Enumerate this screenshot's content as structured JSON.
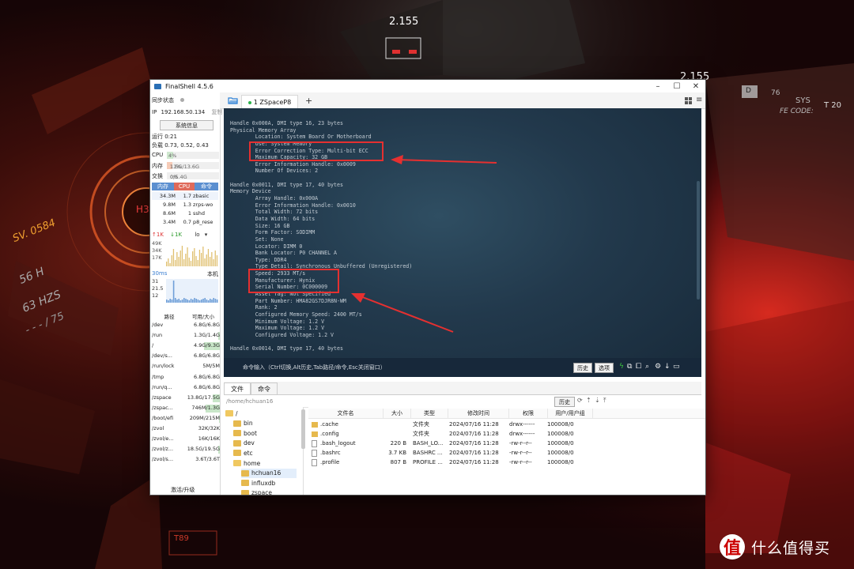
{
  "background": {
    "hud_top_1": "2.155",
    "hud_top_2": "2.155",
    "hud_sv": "SV. 0584",
    "hud_56": "56 H",
    "hud_63": "63 HZS",
    "hud_75": "- - - / 75",
    "hud_sys": "SYS",
    "hud_t20": "T 20",
    "hud_76": "76",
    "hud_fe": "FE CODE:",
    "hud_d": "D",
    "hud_t89": "T89",
    "hud_h3": "H3",
    "watermark_logo": "值",
    "watermark_text": "什么值得买"
  },
  "window": {
    "title": "FinalShell 4.5.6",
    "minimize": "–",
    "maximize": "☐",
    "close": "✕"
  },
  "sidebar": {
    "sync_label": "同步状态",
    "ip_label": "IP",
    "ip_value": "192.168.50.134",
    "copy_label": "复制",
    "sysinfo_button": "系统信息",
    "uptime": "运行 0:21",
    "load": "负载 0.73, 0.52, 0.43",
    "cpu_label": "CPU",
    "cpu_value": "4%",
    "cpu_fraction": 0.04,
    "mem_label": "内存",
    "mem_percent": "11%",
    "mem_value": "1.5G/13.6G",
    "mem_fraction": 0.11,
    "swap_label": "交换",
    "swap_percent": "0%",
    "swap_value": "0/5.4G",
    "proc_headers": [
      "内存",
      "CPU",
      "命令"
    ],
    "processes": [
      {
        "mem": "34.3M",
        "cpu": "1.7",
        "cmd": "zbasic"
      },
      {
        "mem": "9.8M",
        "cpu": "1.3",
        "cmd": "zrps-wo"
      },
      {
        "mem": "8.6M",
        "cpu": "1",
        "cmd": "sshd"
      },
      {
        "mem": "3.4M",
        "cpu": "0.7",
        "cmd": "p8_rese"
      }
    ],
    "net_up": "1K",
    "net_down": "1K",
    "net_iface": "lo",
    "net_ticks": [
      "49K",
      "34K",
      "17K"
    ],
    "latency_label": "30ms",
    "latency_host": "本机",
    "latency_ticks": [
      "31",
      "21.5",
      "12"
    ],
    "disk_headers": [
      "路径",
      "可用/大小"
    ],
    "disks": [
      {
        "path": "/dev",
        "size": "6.8G/6.8G",
        "fraction": 0.0
      },
      {
        "path": "/run",
        "size": "1.3G/1.4G",
        "fraction": 0.05
      },
      {
        "path": "/",
        "size": "4.9G/9.3G",
        "fraction": 0.47
      },
      {
        "path": "/dev/s...",
        "size": "6.8G/6.8G",
        "fraction": 0.0
      },
      {
        "path": "/run/lock",
        "size": "5M/5M",
        "fraction": 0.0
      },
      {
        "path": "/tmp",
        "size": "6.8G/6.8G",
        "fraction": 0.0
      },
      {
        "path": "/run/q...",
        "size": "6.8G/6.8G",
        "fraction": 0.0
      },
      {
        "path": "/zspace",
        "size": "13.8G/17.5G",
        "fraction": 0.21
      },
      {
        "path": "/zspac...",
        "size": "746M/1.3G",
        "fraction": 0.43
      },
      {
        "path": "/boot/efi",
        "size": "209M/215M",
        "fraction": 0.03
      },
      {
        "path": "/zvol",
        "size": "32K/32K",
        "fraction": 0.0
      },
      {
        "path": "/zvol/e...",
        "size": "16K/16K",
        "fraction": 0.0
      },
      {
        "path": "/zvol/z...",
        "size": "18.5G/19.5G",
        "fraction": 0.05
      },
      {
        "path": "/zvol/s...",
        "size": "3.6T/3.6T",
        "fraction": 0.0
      }
    ],
    "activate_label": "激活/升级"
  },
  "tabs": {
    "folder_icon": "folder-open-icon",
    "tab1_label": "1 ZSpaceP8",
    "add_label": "+"
  },
  "terminal": {
    "lines": [
      "Handle 0x000A, DMI type 16, 23 bytes",
      "Physical Memory Array",
      "        Location: System Board Or Motherboard",
      "        Use: System Memory",
      "        Error Correction Type: Multi-bit ECC",
      "        Maximum Capacity: 32 GB",
      "        Error Information Handle: 0x0009",
      "        Number Of Devices: 2",
      "",
      "Handle 0x0011, DMI type 17, 40 bytes",
      "Memory Device",
      "        Array Handle: 0x000A",
      "        Error Information Handle: 0x0010",
      "        Total Width: 72 bits",
      "        Data Width: 64 bits",
      "        Size: 16 GB",
      "        Form Factor: SODIMM",
      "        Set: None",
      "        Locator: DIMM 0",
      "        Bank Locator: P0 CHANNEL A",
      "        Type: DDR4",
      "        Type Detail: Synchronous Unbuffered (Unregistered)",
      "        Speed: 2933 MT/s",
      "        Manufacturer: Hynix",
      "        Serial Number: 0C000009",
      "        Asset Tag: Not Specified",
      "        Part Number: HMA82GS7DJR8N-WM",
      "        Rank: 2",
      "        Configured Memory Speed: 2400 MT/s",
      "        Minimum Voltage: 1.2 V",
      "        Maximum Voltage: 1.2 V",
      "        Configured Voltage: 1.2 V",
      "",
      "Handle 0x0014, DMI type 17, 40 bytes"
    ],
    "cmd_placeholder": "命令输入（Ctrl切换,Alt历史,Tab路径/命令,Esc关闭窗口）",
    "history_button": "历史",
    "options_button": "选项"
  },
  "files": {
    "tab_files": "文件",
    "tab_commands": "命令",
    "path": "/home/hchuan16",
    "history_button": "历史",
    "tree": [
      {
        "name": "/",
        "level": 0,
        "open": true
      },
      {
        "name": "bin",
        "level": 1,
        "open": false
      },
      {
        "name": "boot",
        "level": 1,
        "open": false
      },
      {
        "name": "dev",
        "level": 1,
        "open": false
      },
      {
        "name": "etc",
        "level": 1,
        "open": false
      },
      {
        "name": "home",
        "level": 1,
        "open": true
      },
      {
        "name": "hchuan16",
        "level": 2,
        "open": false
      },
      {
        "name": "influxdb",
        "level": 2,
        "open": false
      },
      {
        "name": "zspace",
        "level": 2,
        "open": false
      }
    ],
    "columns": [
      "文件名",
      "大小",
      "类型",
      "修改时间",
      "权限",
      "用户/用户组"
    ],
    "rows": [
      {
        "name": ".cache",
        "size": "",
        "type": "文件夹",
        "mtime": "2024/07/16 11:28",
        "perm": "drwx------",
        "owner": "100008/0",
        "kind": "folder"
      },
      {
        "name": ".config",
        "size": "",
        "type": "文件夹",
        "mtime": "2024/07/16 11:28",
        "perm": "drwx------",
        "owner": "100008/0",
        "kind": "folder"
      },
      {
        "name": ".bash_logout",
        "size": "220 B",
        "type": "BASH_LO...",
        "mtime": "2024/07/16 11:28",
        "perm": "-rw-r--r--",
        "owner": "100008/0",
        "kind": "file"
      },
      {
        "name": ".bashrc",
        "size": "3.7 KB",
        "type": "BASHRC ...",
        "mtime": "2024/07/16 11:28",
        "perm": "-rw-r--r--",
        "owner": "100008/0",
        "kind": "file"
      },
      {
        "name": ".profile",
        "size": "807 B",
        "type": "PROFILE ...",
        "mtime": "2024/07/16 11:28",
        "perm": "-rw-r--r--",
        "owner": "100008/0",
        "kind": "file"
      }
    ]
  },
  "colors": {
    "annotation_red": "#e53030",
    "accent_blue": "#3b7fd1",
    "cpu_fill": "#8fd38f",
    "mem_fill": "#f2b9a0",
    "disk_fill": "#9fd59f"
  }
}
